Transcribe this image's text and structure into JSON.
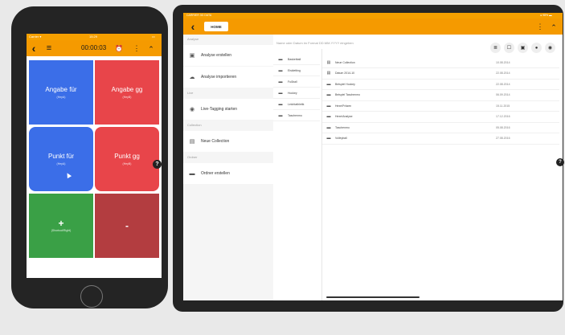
{
  "phone": {
    "status": {
      "carrier": "Carrier ▾",
      "time": "15:29",
      "battery": "▭"
    },
    "appbar": {
      "timer": "00:00:03",
      "alarm_icon": "⏰",
      "menu_icon": "≡",
      "more_icon": "⋮",
      "expand_icon": "⌃",
      "back_icon": "‹"
    },
    "tiles": [
      {
        "label": "Angabe für",
        "sub": "(HeyA)",
        "color": "#3b6ee8"
      },
      {
        "label": "Angabe gg",
        "sub": "(HeyB)",
        "color": "#e8454a"
      },
      {
        "label": "Punkt für",
        "sub": "(HeyA)",
        "color": "#3b6ee8"
      },
      {
        "label": "Punkt gg",
        "sub": "(HeyB)",
        "color": "#e8454a"
      },
      {
        "label": "+",
        "sub": "(Shortcut/Right)",
        "color": "#3aa046"
      },
      {
        "label": "-",
        "sub": "",
        "color": "#b33d40"
      }
    ],
    "help_icon": "?"
  },
  "tablet": {
    "status": {
      "left": "CARRIER 3G DATA",
      "right": "● 98% ▬"
    },
    "appbar": {
      "back_icon": "‹",
      "home_label": "HOME",
      "more_icon": "⋮",
      "expand_icon": "⌃"
    },
    "search_placeholder": "Name oder Datum im Format DD.MM.YYYY eingeben",
    "toolbar": [
      "≣",
      "☐",
      "▣",
      "●",
      "◉"
    ],
    "sidebar": {
      "sections": [
        {
          "label": "Analyse",
          "items": [
            {
              "icon": "▣",
              "label": "Analyse erstellen"
            },
            {
              "icon": "☁",
              "label": "Analyse importieren"
            }
          ]
        },
        {
          "label": "Live",
          "items": [
            {
              "icon": "◉",
              "label": "Live-Tagging starten"
            }
          ]
        },
        {
          "label": "Collection",
          "items": [
            {
              "icon": "▤",
              "label": "Neue Collection"
            }
          ]
        },
        {
          "label": "Ordner",
          "items": [
            {
              "icon": "▬",
              "label": "Ordner erstellen"
            }
          ]
        }
      ]
    },
    "folders": [
      "Basketball",
      "Eiskletting",
      "Fußball",
      "Hockey",
      "Leichtathletik",
      "Taschenmo"
    ],
    "files": [
      {
        "icon": "▤",
        "name": "Neue Collection",
        "date": "10.08.2014"
      },
      {
        "icon": "▤",
        "name": "Datum 2014-10",
        "date": "22.08.2014"
      },
      {
        "icon": "▬",
        "name": "Beispiel Hockey",
        "date": "22.08.2014"
      },
      {
        "icon": "▬",
        "name": "Beispiel Taschenmo",
        "date": "06.09.2014"
      },
      {
        "icon": "▬",
        "name": "Hexe/Präzen",
        "date": "15.11.2015"
      },
      {
        "icon": "▬",
        "name": "Hexe/Analyse",
        "date": "17.12.2016"
      },
      {
        "icon": "▬",
        "name": "Taschenmo",
        "date": "05.08.2016"
      },
      {
        "icon": "▬",
        "name": "Volleyball",
        "date": "27.08.2016"
      }
    ],
    "help_icon": "?"
  }
}
